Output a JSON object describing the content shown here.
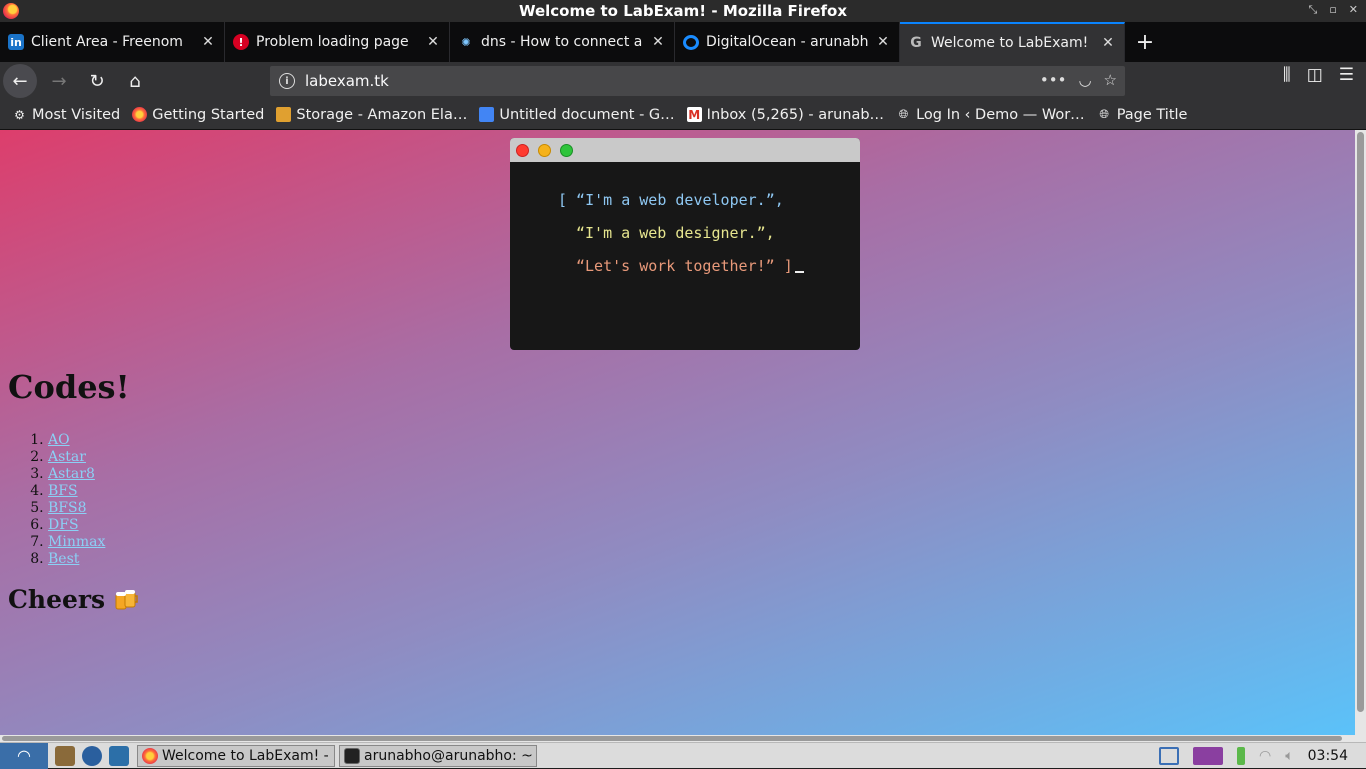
{
  "window": {
    "title": "Welcome to LabExam! - Mozilla Firefox"
  },
  "tabs": [
    {
      "label": "Client Area - Freenom",
      "icon": "freenom-icon"
    },
    {
      "label": "Problem loading page",
      "icon": "error-icon"
    },
    {
      "label": "dns - How to connect a F",
      "icon": "bulb-icon"
    },
    {
      "label": "DigitalOcean - arunabho",
      "icon": "digitalocean-icon"
    },
    {
      "label": "Welcome to LabExam!",
      "icon": "google-icon",
      "active": true
    }
  ],
  "url": "labexam.tk",
  "bookmarks": [
    {
      "label": "Most Visited",
      "icon": "gear-icon"
    },
    {
      "label": "Getting Started",
      "icon": "firefox-icon"
    },
    {
      "label": "Storage - Amazon Ela…",
      "icon": "box-icon"
    },
    {
      "label": "Untitled document - G…",
      "icon": "docs-icon"
    },
    {
      "label": "Inbox (5,265) - arunab…",
      "icon": "gmail-icon"
    },
    {
      "label": "Log In ‹ Demo — Wor…",
      "icon": "globe-icon"
    },
    {
      "label": "Page Title",
      "icon": "globe-icon"
    }
  ],
  "terminal": {
    "line1": "[ “I'm a web developer.”,",
    "line2": "“I'm a web designer.”,",
    "line3": "“Let's work together!” ]"
  },
  "page": {
    "heading": "Codes!",
    "links": [
      "AO",
      "Astar",
      "Astar8",
      "BFS",
      "BFS8",
      "DFS",
      "Minmax",
      "Best"
    ],
    "footer_heading": "Cheers"
  },
  "taskbar": {
    "tasks": [
      {
        "label": "Welcome to LabExam! - ...",
        "icon": "firefox-icon"
      },
      {
        "label": "arunabho@arunabho: ~",
        "icon": "terminal-icon"
      }
    ],
    "clock": "03:54"
  },
  "colors": {
    "gradient_start": "#dd3e6c",
    "gradient_end": "#5bc2f9",
    "link": "#8bd0f5",
    "accent": "#0a84ff"
  }
}
